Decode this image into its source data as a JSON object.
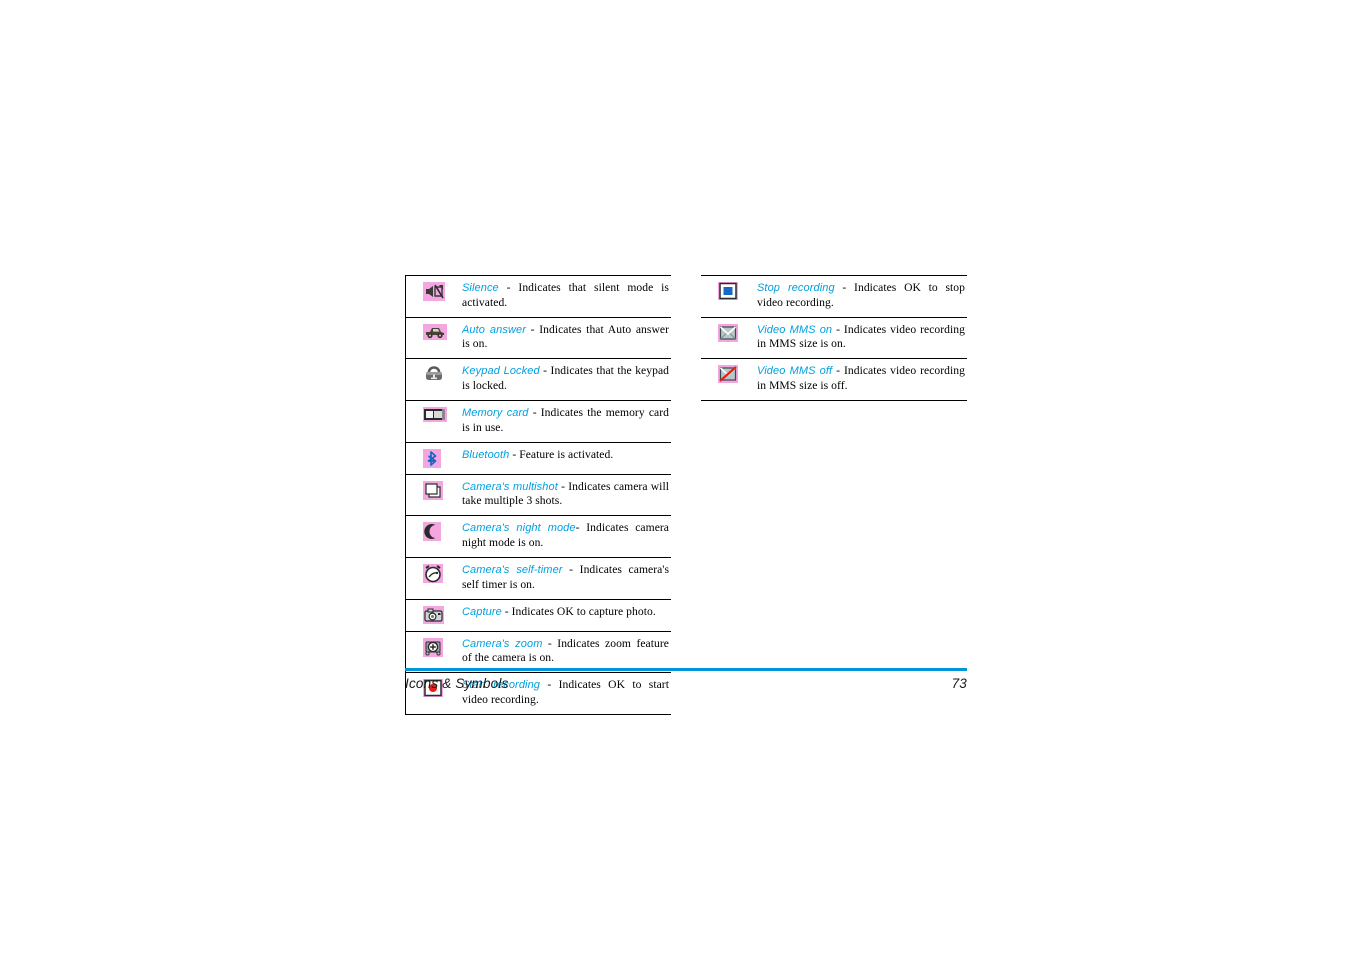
{
  "page": {
    "footer_section": "Icons & Symbols",
    "page_number": "73",
    "accent_color": "#0095d9",
    "term_color": "#00a0e0",
    "icon_bg_color": "#f4a6e0"
  },
  "columns": [
    {
      "name": "left-column",
      "rows": [
        {
          "icon": "silence-icon",
          "term": "Silence",
          "description": " - Indicates that silent mode is activated."
        },
        {
          "icon": "auto-answer-car-icon",
          "term": "Auto answer",
          "description": " - Indicates that Auto answer is on."
        },
        {
          "icon": "keypad-locked-padlock-icon",
          "term": "Keypad Locked",
          "description": " - Indicates that the keypad is locked."
        },
        {
          "icon": "memory-card-icon",
          "term": "Memory card",
          "description": " - Indicates the memory card is in use."
        },
        {
          "icon": "bluetooth-icon",
          "term": "Bluetooth",
          "description": " - Feature is activated."
        },
        {
          "icon": "camera-multishot-icon",
          "term": "Camera's multishot",
          "description": " - Indicates camera will take multiple 3 shots."
        },
        {
          "icon": "camera-night-mode-moon-icon",
          "term": "Camera's night mode",
          "description": "- Indicates camera night mode is on."
        },
        {
          "icon": "camera-self-timer-clock-icon",
          "term": "Camera's self-timer",
          "description": " - Indicates camera's self timer is on."
        },
        {
          "icon": "capture-camera-icon",
          "term": "Capture",
          "description": " - Indicates OK to capture photo."
        },
        {
          "icon": "camera-zoom-icon",
          "term": "Camera's zoom",
          "description": " - Indicates zoom feature of the camera is on."
        },
        {
          "icon": "start-recording-icon",
          "term": "Start recording",
          "description": " - Indicates OK to start video recording."
        }
      ]
    },
    {
      "name": "right-column",
      "rows": [
        {
          "icon": "stop-recording-icon",
          "term": "Stop recording",
          "description": " - Indicates OK to stop video recording."
        },
        {
          "icon": "video-mms-on-envelope-icon",
          "term": "Video MMS on",
          "description": " - Indicates video recording in MMS size is on."
        },
        {
          "icon": "video-mms-off-envelope-icon",
          "term": "Video MMS off",
          "description": " - Indicates video recording in MMS size is off."
        }
      ]
    }
  ]
}
